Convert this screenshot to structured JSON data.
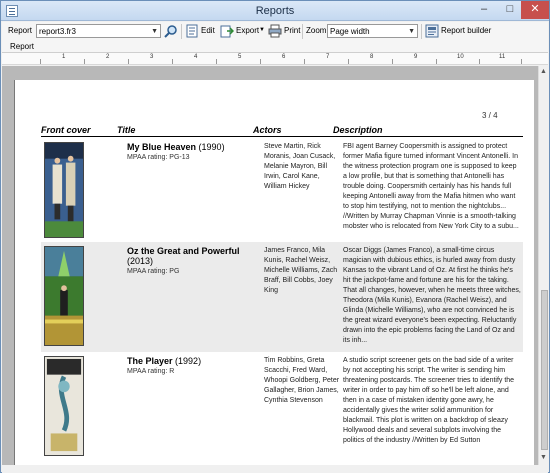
{
  "window": {
    "title": "Reports"
  },
  "toolbar": {
    "report_label": "Report",
    "report_value": "report3.fr3",
    "edit_label": "Edit",
    "export_label": "Export",
    "print_label": "Print",
    "zoom_label": "Zoom",
    "zoom_value": "Page width",
    "report_builder_label": "Report builder"
  },
  "tabs": [
    "Report"
  ],
  "ruler": [
    "1",
    "2",
    "3",
    "4",
    "5",
    "6",
    "7",
    "8",
    "9",
    "10",
    "11"
  ],
  "page": {
    "indicator": "3 / 4",
    "headers": {
      "cover": "Front cover",
      "title": "Title",
      "actors": "Actors",
      "description": "Description"
    },
    "movies": [
      {
        "title": "My Blue Heaven",
        "year": "(1990)",
        "rating": "MPAA rating: PG-13",
        "actors": "Steve Martin, Rick Moranis, Joan Cusack, Melanie Mayron, Bill Irwin, Carol Kane, William Hickey",
        "description": "FBI agent Barney Coopersmith is assigned to protect former Mafia figure turned informant Vincent Antonelli. In the witness protection program one is supposed to keep a low profile, but that is something that Antonelli has trouble doing. Coopersmith certainly has his hands full keeping Antonelli away from the Mafia hitmen who want to stop him testifying, not to mention the nightclubs... //Written by Murray Chapman Vinnie is a smooth-talking mobster who is relocated from New York City to a subu..."
      },
      {
        "title": "Oz the Great and Powerful",
        "year": "(2013)",
        "rating": "MPAA rating: PG",
        "actors": "James Franco, Mila Kunis, Rachel Weisz, Michelle Williams, Zach Braff, Bill Cobbs, Joey King",
        "description": "Oscar Diggs (James Franco), a small-time circus magician with dubious ethics, is hurled away from dusty Kansas to the vibrant Land of Oz. At first he thinks he's hit the jackpot-fame and fortune are his for the taking. That all changes, however, when he meets three witches, Theodora (Mila Kunis), Evanora (Rachel Weisz), and Glinda (Michelle Williams), who are not convinced he is the great wizard everyone's been expecting. Reluctantly drawn into the epic problems facing the Land of Oz and its inh..."
      },
      {
        "title": "The Player",
        "year": "(1992)",
        "rating": "MPAA rating: R",
        "actors": "Tim Robbins, Greta Scacchi, Fred Ward, Whoopi Goldberg, Peter Gallagher, Brion James, Cynthia Stevenson",
        "description": "A studio script screener gets on the bad side of a writer by not accepting his script. The writer is sending him threatening postcards. The screener tries to identify the writer in order to pay him off so he'll be left alone, and then in a case of mistaken identity gone awry, he accidentally gives the writer solid ammunition for blackmail. This plot is written on a backdrop of sleazy Hollywood deals and several subplots involving the politics of the industry //Written by Ed Sutton"
      }
    ]
  }
}
